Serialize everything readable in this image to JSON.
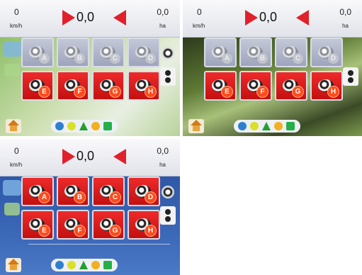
{
  "screens": [
    {
      "id": "s1",
      "header": {
        "speed_value": "0",
        "speed_unit": "km/h",
        "counter": "0,0",
        "area_value": "0,0",
        "area_unit": "ha"
      },
      "sections": [
        {
          "label": "A",
          "state": "off"
        },
        {
          "label": "B",
          "state": "off"
        },
        {
          "label": "C",
          "state": "off"
        },
        {
          "label": "D",
          "state": "off"
        },
        {
          "label": "E",
          "state": "on"
        },
        {
          "label": "F",
          "state": "on"
        },
        {
          "label": "G",
          "state": "on"
        },
        {
          "label": "H",
          "state": "on"
        }
      ]
    },
    {
      "id": "s2",
      "header": {
        "speed_value": "0",
        "speed_unit": "km/h",
        "counter": "0,0",
        "area_value": "0,0",
        "area_unit": "ha"
      },
      "sections": [
        {
          "label": "A",
          "state": "off"
        },
        {
          "label": "B",
          "state": "off"
        },
        {
          "label": "C",
          "state": "off"
        },
        {
          "label": "D",
          "state": "off"
        },
        {
          "label": "E",
          "state": "on"
        },
        {
          "label": "F",
          "state": "on"
        },
        {
          "label": "G",
          "state": "on"
        },
        {
          "label": "H",
          "state": "on"
        }
      ]
    },
    {
      "id": "s3",
      "header": {
        "speed_value": "0",
        "speed_unit": "km/h",
        "counter": "0,0",
        "area_value": "0,0",
        "area_unit": "ha"
      },
      "sections": [
        {
          "label": "A",
          "state": "on"
        },
        {
          "label": "B",
          "state": "on"
        },
        {
          "label": "C",
          "state": "on"
        },
        {
          "label": "D",
          "state": "on"
        },
        {
          "label": "E",
          "state": "on"
        },
        {
          "label": "F",
          "state": "on"
        },
        {
          "label": "G",
          "state": "on"
        },
        {
          "label": "H",
          "state": "on"
        }
      ]
    }
  ],
  "colors": {
    "active": "#e0202a",
    "inactive": "#a4a9c0",
    "badge_active": "#ff4a1a"
  },
  "icons": [
    "home-icon",
    "gauge-icon",
    "level-icon",
    "spray-icon",
    "coin-icon",
    "boom-icon"
  ]
}
